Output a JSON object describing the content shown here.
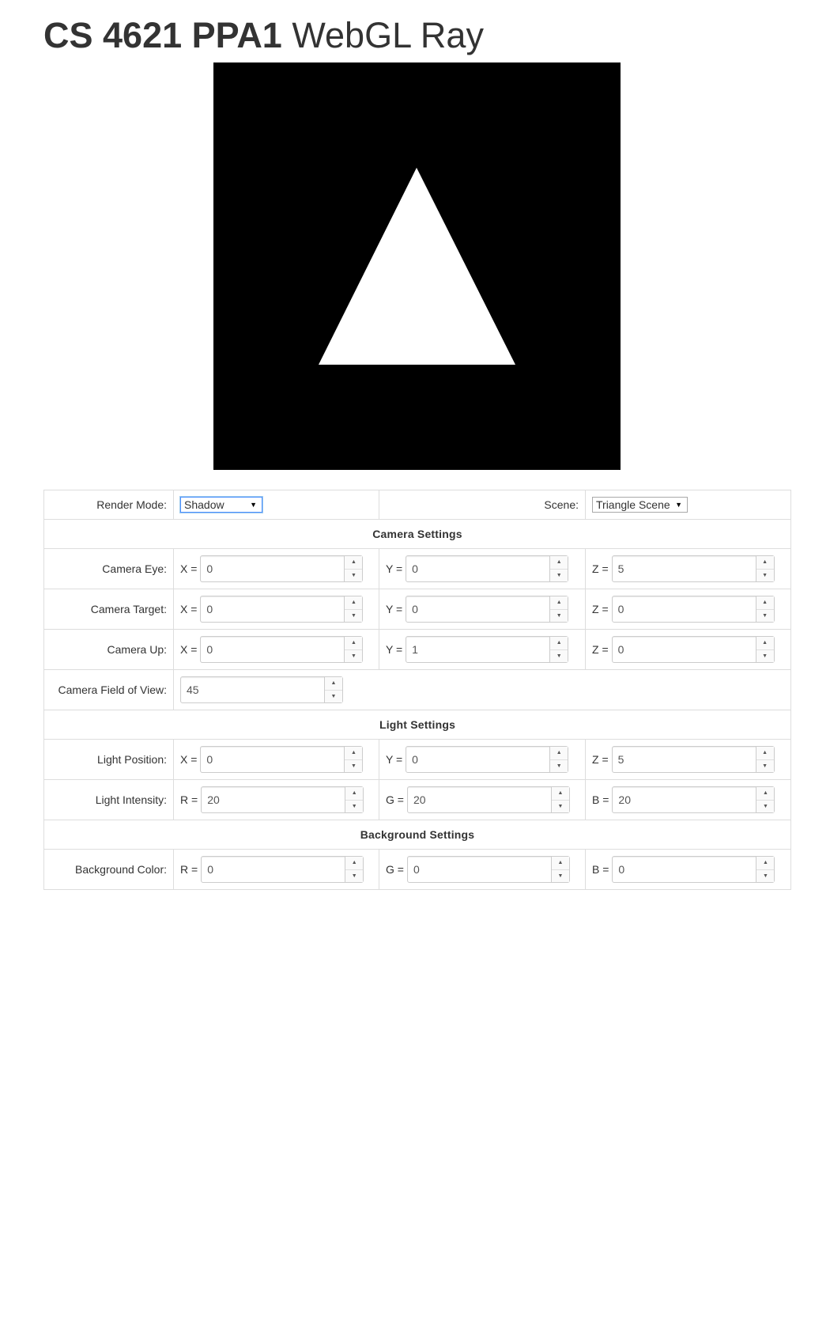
{
  "title": {
    "course": "CS 4621 PPA1",
    "project": "WebGL Ray"
  },
  "colors": {
    "canvas_background": "#000000",
    "triangle_fill": "#ffffff",
    "select_focus": "#4d90fe"
  },
  "controls": {
    "render_mode": {
      "label": "Render Mode:",
      "value": "Shadow"
    },
    "scene": {
      "label": "Scene:",
      "value": "Triangle Scene"
    }
  },
  "sections": {
    "camera": "Camera Settings",
    "light": "Light Settings",
    "background": "Background Settings"
  },
  "camera": {
    "eye": {
      "label": "Camera Eye:",
      "x": "0",
      "y": "0",
      "z": "5"
    },
    "target": {
      "label": "Camera Target:",
      "x": "0",
      "y": "0",
      "z": "0"
    },
    "up": {
      "label": "Camera Up:",
      "x": "0",
      "y": "1",
      "z": "0"
    },
    "fov": {
      "label": "Camera Field of View:",
      "value": "45"
    }
  },
  "light": {
    "position": {
      "label": "Light Position:",
      "x": "0",
      "y": "0",
      "z": "5"
    },
    "intensity": {
      "label": "Light Intensity:",
      "r": "20",
      "g": "20",
      "b": "20"
    }
  },
  "background": {
    "color": {
      "label": "Background Color:",
      "r": "0",
      "g": "0",
      "b": "0"
    }
  },
  "axis_labels": {
    "x": "X =",
    "y": "Y =",
    "z": "Z =",
    "r": "R =",
    "g": "G =",
    "b": "B ="
  },
  "icons": {
    "spin_up": "▲",
    "spin_down": "▼",
    "dropdown": "▼"
  }
}
